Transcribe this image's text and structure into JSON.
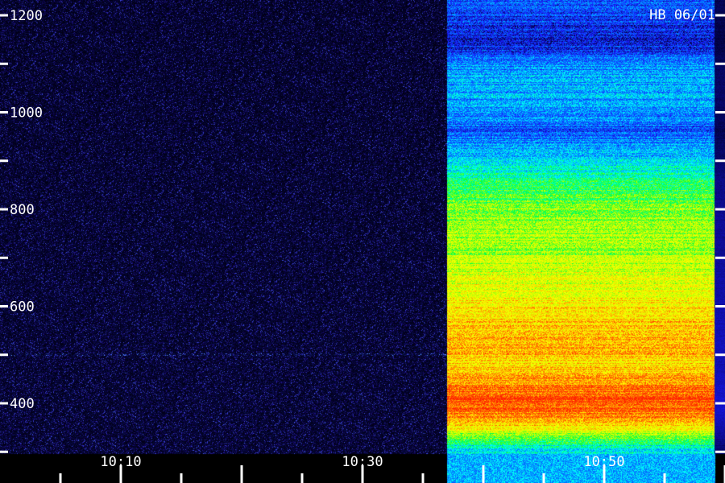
{
  "chart_data": {
    "type": "heatmap",
    "title": "HB 06/01",
    "xlabel": "",
    "ylabel": "",
    "y_ticks": [
      400,
      600,
      800,
      1000,
      1200
    ],
    "y_minor_ticks": [
      300,
      500,
      700,
      900,
      1100
    ],
    "x_ticks": [
      "10:10",
      "10:30",
      "10:50"
    ],
    "ylim": [
      300,
      1230
    ],
    "time_range_minutes": [
      "10:00",
      "10:59"
    ],
    "signal_onset": "10:37",
    "colormap": [
      "#000033",
      "#1a1aff",
      "#0080ff",
      "#00ffff",
      "#00ff40",
      "#c8ff00",
      "#ffff00",
      "#ff8000",
      "#ff2000"
    ],
    "intensity_profile_after_onset": [
      {
        "y": 1210,
        "level": 0.18
      },
      {
        "y": 1150,
        "level": 0.1
      },
      {
        "y": 1100,
        "level": 0.25
      },
      {
        "y": 1060,
        "level": 0.3
      },
      {
        "y": 1010,
        "level": 0.28
      },
      {
        "y": 960,
        "level": 0.2
      },
      {
        "y": 920,
        "level": 0.3
      },
      {
        "y": 880,
        "level": 0.4
      },
      {
        "y": 840,
        "level": 0.5
      },
      {
        "y": 800,
        "level": 0.58
      },
      {
        "y": 760,
        "level": 0.62
      },
      {
        "y": 720,
        "level": 0.6
      },
      {
        "y": 680,
        "level": 0.66
      },
      {
        "y": 640,
        "level": 0.7
      },
      {
        "y": 600,
        "level": 0.76
      },
      {
        "y": 560,
        "level": 0.8
      },
      {
        "y": 520,
        "level": 0.82
      },
      {
        "y": 480,
        "level": 0.78
      },
      {
        "y": 440,
        "level": 0.86
      },
      {
        "y": 410,
        "level": 0.97
      },
      {
        "y": 390,
        "level": 0.92
      },
      {
        "y": 360,
        "level": 0.82
      },
      {
        "y": 330,
        "level": 0.55
      },
      {
        "y": 310,
        "level": 0.38
      }
    ]
  }
}
